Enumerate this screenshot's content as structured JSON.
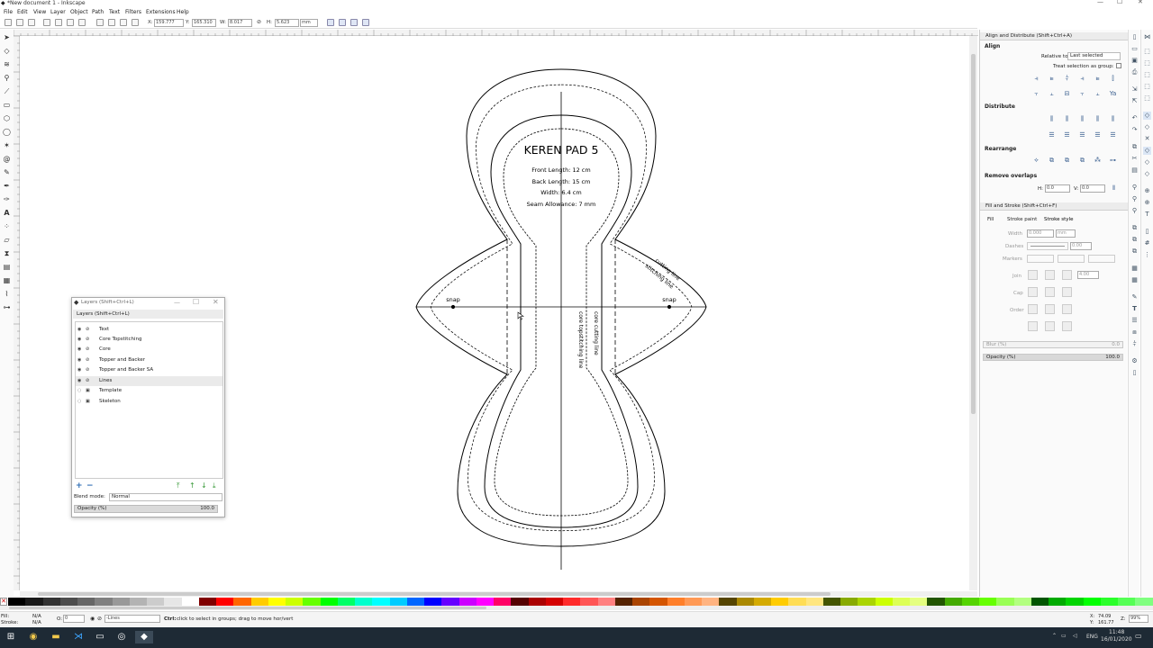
{
  "window": {
    "title": "*New document 1 - Inkscape",
    "minimize": "—",
    "maximize": "☐",
    "close": "✕"
  },
  "menu": [
    "File",
    "Edit",
    "View",
    "Layer",
    "Object",
    "Path",
    "Text",
    "Filters",
    "Extensions",
    "Help"
  ],
  "toolctrl": {
    "x_label": "X:",
    "x_value": "159.777",
    "y_label": "Y:",
    "y_value": "165.310",
    "w_label": "W:",
    "w_value": "8.017",
    "h_label": "H:",
    "h_value": "5.623",
    "unit": "mm"
  },
  "tools": [
    "select-arrow",
    "node",
    "tweak",
    "zoom",
    "measure",
    "rectangle",
    "3d-box",
    "ellipse",
    "star",
    "spiral",
    "pencil",
    "pen",
    "calligraphy",
    "text",
    "spray",
    "eraser",
    "bucket",
    "gradient",
    "mesh",
    "dropper",
    "connector"
  ],
  "canvas": {
    "title": "KEREN PAD 5",
    "lines": [
      "Front Length: 12 cm",
      "Back Length: 15 cm",
      "Width: 6.4 cm",
      "Seam Allowance: 7 mm"
    ],
    "snap_left": "snap",
    "snap_right": "snap",
    "cutting_line": "cutting line",
    "stitching_line": "stitching line",
    "core_cutting_line": "core cutting line",
    "core_topstitching_line": "core topstitching line"
  },
  "align_panel": {
    "header": "Align and Distribute (Shift+Ctrl+A)",
    "align": "Align",
    "relative_to_label": "Relative to:",
    "relative_to_value": "Last selected",
    "treat_group": "Treat selection as group:",
    "distribute": "Distribute",
    "rearrange": "Rearrange",
    "remove_overlaps": "Remove overlaps",
    "h_label": "H:",
    "h_value": "0.0",
    "v_label": "V:",
    "v_value": "0.0"
  },
  "fill_panel": {
    "header": "Fill and Stroke (Shift+Ctrl+F)",
    "tabs": [
      "Fill",
      "Stroke paint",
      "Stroke style"
    ],
    "width_label": "Width",
    "width_value": "0.000",
    "width_unit": "mm",
    "dashes_label": "Dashes",
    "dashes_value": "0.00",
    "markers_label": "Markers",
    "join_label": "Join",
    "join_value": "4.00",
    "cap_label": "Cap",
    "order_label": "Order",
    "blur_label": "Blur (%)",
    "blur_value": "0.0",
    "opacity_label": "Opacity (%)",
    "opacity_value": "100.0"
  },
  "layers_panel": {
    "window_title": "Layers (Shift+Ctrl+L)",
    "header": "Layers (Shift+Ctrl+L)",
    "layers": [
      {
        "name": "Text",
        "visible": true,
        "locked": false
      },
      {
        "name": "Core Topstitching",
        "visible": true,
        "locked": false
      },
      {
        "name": "Core",
        "visible": true,
        "locked": false
      },
      {
        "name": "Topper and Backer",
        "visible": true,
        "locked": false
      },
      {
        "name": "Topper and Backer SA",
        "visible": true,
        "locked": false
      },
      {
        "name": "Lines",
        "visible": true,
        "locked": false,
        "selected": true
      },
      {
        "name": "Template",
        "visible": false,
        "locked": true
      },
      {
        "name": "Skeleton",
        "visible": false,
        "locked": true
      }
    ],
    "blend_label": "Blend mode:",
    "blend_value": "Normal",
    "opacity_label": "Opacity (%)",
    "opacity_value": "100.0"
  },
  "status": {
    "fill_label": "Fill:",
    "fill_value": "N/A",
    "stroke_label": "Stroke:",
    "stroke_value": "N/A",
    "o_label": "O:",
    "o_value": "0",
    "layer_value": "-Lines",
    "message_bold": "Ctrl:",
    "message": "click to select in groups; drag to move hor/vert",
    "x_label": "X:",
    "x_value": "74.09",
    "y_label": "Y:",
    "y_value": "161.77",
    "z_label": "Z:",
    "zoom": "99%"
  },
  "taskbar": {
    "lang": "ENG",
    "time": "11:48",
    "date": "16/01/2020"
  },
  "palette": [
    "#000000",
    "#1a1a1a",
    "#333333",
    "#4d4d4d",
    "#666666",
    "#808080",
    "#999999",
    "#b3b3b3",
    "#cccccc",
    "#e6e6e6",
    "#ffffff",
    "#800000",
    "#ff0000",
    "#ff6600",
    "#ffcc00",
    "#ffff00",
    "#ccff00",
    "#66ff00",
    "#00ff00",
    "#00ff66",
    "#00ffcc",
    "#00ffff",
    "#00ccff",
    "#0066ff",
    "#0000ff",
    "#6600ff",
    "#cc00ff",
    "#ff00ff",
    "#ff0066",
    "#550000",
    "#aa0000",
    "#d40000",
    "#ff2a2a",
    "#ff5555",
    "#ff8080",
    "#552200",
    "#aa4400",
    "#d45500",
    "#ff7f2a",
    "#ff9955",
    "#ffb380",
    "#554400",
    "#aa8800",
    "#d4aa00",
    "#ffcc00",
    "#ffdd55",
    "#ffe680",
    "#445500",
    "#88aa00",
    "#aad400",
    "#ccff00",
    "#ddff55",
    "#e5ff80",
    "#225500",
    "#44aa00",
    "#55d400",
    "#66ff00",
    "#99ff55",
    "#b3ff80",
    "#005500",
    "#00aa00",
    "#00d400",
    "#00ff00",
    "#2aff2a",
    "#55ff55",
    "#80ff80"
  ]
}
